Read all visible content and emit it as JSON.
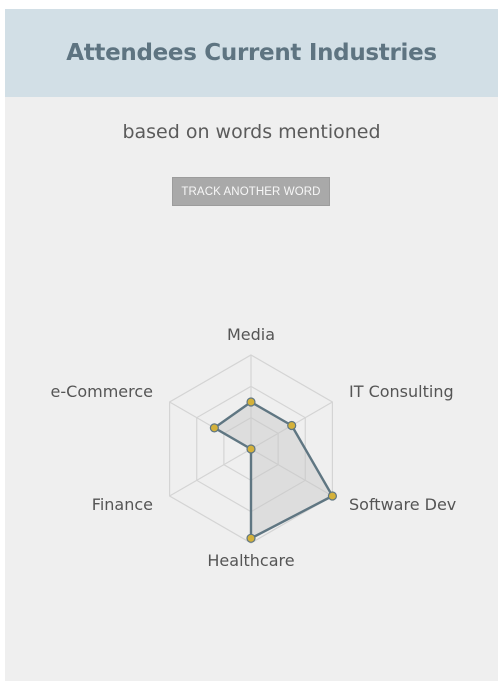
{
  "header": {
    "title": "Attendees Current Industries"
  },
  "subtitle": "based on words mentioned",
  "toolbar": {
    "track_label": "TRACK ANOTHER WORD"
  },
  "colors": {
    "series_stroke": "#5f7682",
    "point_fill": "#d4b13a",
    "grid": "#d4d4d4"
  },
  "chart_data": {
    "type": "radar",
    "categories": [
      "Media",
      "IT Consulting",
      "Software Dev",
      "Healthcare",
      "Finance",
      "e-Commerce"
    ],
    "series": [
      {
        "values": [
          0.5,
          0.5,
          1.0,
          0.95,
          0.0,
          0.45
        ]
      }
    ],
    "rlim": [
      0,
      1
    ],
    "grid_levels": 3,
    "legend": "none"
  }
}
